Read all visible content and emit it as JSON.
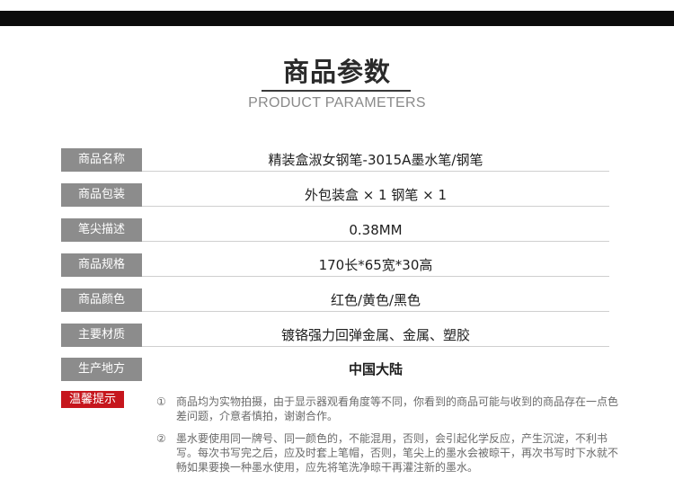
{
  "header": {
    "title": "商品参数",
    "subtitle": "PRODUCT PARAMETERS"
  },
  "params": [
    {
      "label": "商品名称",
      "value": "精装盒淑女钢笔-3015A墨水笔/钢笔"
    },
    {
      "label": "商品包装",
      "value": "外包装盒 × 1 钢笔 × 1"
    },
    {
      "label": "笔尖描述",
      "value": "0.38MM"
    },
    {
      "label": "商品规格",
      "value": "170长*65宽*30高"
    },
    {
      "label": "商品颜色",
      "value": "红色/黄色/黑色"
    },
    {
      "label": "主要材质",
      "value": "镀铬强力回弹金属、金属、塑胶"
    },
    {
      "label": "生产地方",
      "value": "中国大陆"
    }
  ],
  "tips": {
    "badge": "温馨提示",
    "notes": [
      {
        "num": "①",
        "text": "商品均为实物拍摄，由于显示器观看角度等不同，你看到的商品可能与收到的商品存在一点色差问题，介意者慎拍，谢谢合作。"
      },
      {
        "num": "②",
        "text": "墨水要使用同一牌号、同一颜色的，不能混用，否则，会引起化学反应，产生沉淀，不利书写。每次书写完之后，应及时套上笔帽，否则，笔尖上的墨水会被晾干，再次书写时下水就不畅如果要换一种墨水使用，应先将笔洗净晾干再灌注新的墨水。"
      }
    ]
  },
  "colors": {
    "label_bg": "#8c8c8c",
    "badge_bg": "#c6161d",
    "top_bar": "#0c0c0c"
  }
}
